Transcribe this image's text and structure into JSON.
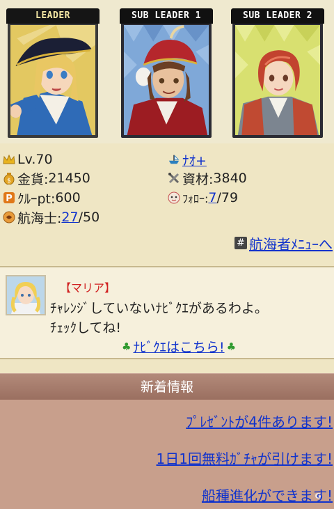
{
  "leaders": [
    {
      "tag": "LEADER"
    },
    {
      "tag": "SUB LEADER 1"
    },
    {
      "tag": "SUB LEADER 2"
    }
  ],
  "stats": {
    "level": "Lv.70",
    "gold_label": "金貨:",
    "gold_value": "21450",
    "crew_pt_label": "ｸﾙｰpt:",
    "crew_pt_value": "600",
    "navigator_label": "航海士:",
    "navigator_current": "27",
    "navigator_max": "/50",
    "user_name": "ﾅｵ+",
    "materials_label": "資材:",
    "materials_value": "3840",
    "follow_label": "ﾌｫﾛｰ:",
    "follow_current": "7",
    "follow_max": "/79",
    "menu_link": "航海者ﾒﾆｭｰへ"
  },
  "message": {
    "name": "【マリア】",
    "line1": "ﾁｬﾚﾝｼﾞしていないﾅﾋﾞｸｴがあるわよ。",
    "line2": "ﾁｪｯｸしてね!",
    "navi_link": "ﾅﾋﾞｸｴはこちら!"
  },
  "news": {
    "title": "新着情報",
    "items": [
      "ﾌﾟﾚｾﾞﾝﾄが4件あります!",
      "1日1回無料ｶﾞﾁｬが引けます!",
      "船種進化ができます!"
    ]
  },
  "colors": {
    "link": "#1133cc",
    "name_red": "#d02020",
    "news_bg": "#c89f8c",
    "news_header": "#a87c6c"
  },
  "icons": [
    "crown-icon",
    "gold-bag-icon",
    "crew-p-icon",
    "navigator-icon",
    "ship-icon",
    "tools-icon",
    "follow-face-icon",
    "hash-icon",
    "clover-icon"
  ]
}
